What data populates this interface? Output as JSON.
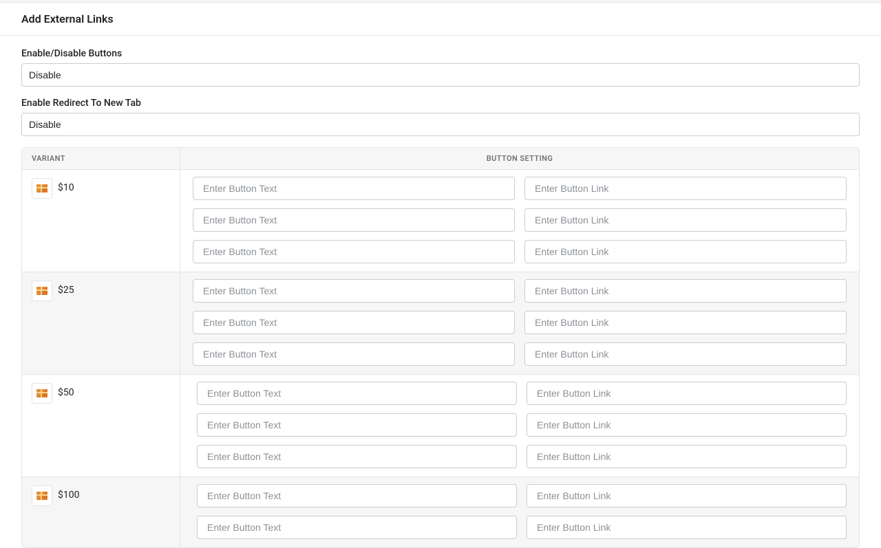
{
  "header": {
    "title": "Add External Links"
  },
  "fields": {
    "enable_buttons": {
      "label": "Enable/Disable Buttons",
      "value": "Disable"
    },
    "enable_redirect": {
      "label": "Enable Redirect To New Tab",
      "value": "Disable"
    }
  },
  "table": {
    "columns": {
      "variant": "Variant",
      "setting": "Button Setting"
    },
    "placeholders": {
      "text": "Enter Button Text",
      "link": "Enter Button Link"
    },
    "variants": [
      {
        "label": "$10"
      },
      {
        "label": "$25"
      },
      {
        "label": "$50"
      },
      {
        "label": "$100"
      }
    ]
  }
}
